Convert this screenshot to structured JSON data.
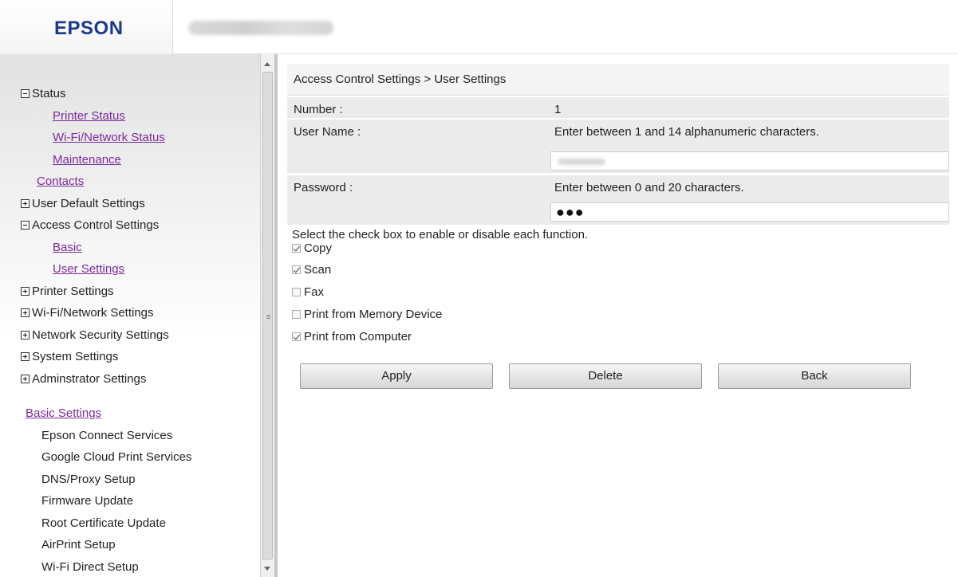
{
  "header": {
    "logo": "EPSON"
  },
  "sidebar": {
    "nav": [
      {
        "label": "Status",
        "toggle": "minus"
      },
      {
        "label": "Printer Status",
        "link": true,
        "level": 2
      },
      {
        "label": "Wi-Fi/Network Status",
        "link": true,
        "level": 2
      },
      {
        "label": "Maintenance",
        "link": true,
        "level": 2
      },
      {
        "label": "Contacts",
        "link": true,
        "level": 1
      },
      {
        "label": "User Default Settings",
        "toggle": "plus"
      },
      {
        "label": "Access Control Settings",
        "toggle": "minus"
      },
      {
        "label": "Basic",
        "link": true,
        "level": 2
      },
      {
        "label": "User Settings",
        "link": true,
        "level": 2
      },
      {
        "label": "Printer Settings",
        "toggle": "plus"
      },
      {
        "label": "Wi-Fi/Network Settings",
        "toggle": "plus"
      },
      {
        "label": "Network Security Settings",
        "toggle": "plus"
      },
      {
        "label": "System Settings",
        "toggle": "plus"
      },
      {
        "label": "Adminstrator Settings",
        "toggle": "plus"
      }
    ],
    "basic_settings": {
      "title": "Basic Settings",
      "items": [
        "Epson Connect Services",
        "Google Cloud Print Services",
        "DNS/Proxy Setup",
        "Firmware Update",
        "Root Certificate Update",
        "AirPrint Setup",
        "Wi-Fi Direct Setup"
      ]
    }
  },
  "main": {
    "breadcrumb": "Access Control Settings > User Settings",
    "number": {
      "label": "Number :",
      "value": "1"
    },
    "user_name": {
      "label": "User Name :",
      "hint": "Enter between 1 and 14 alphanumeric characters."
    },
    "password": {
      "label": "Password :",
      "hint": "Enter between 0 and 20 characters.",
      "value": "●●●"
    },
    "instruction": "Select the check box to enable or disable each function.",
    "functions": [
      {
        "label": "Copy",
        "checked": true
      },
      {
        "label": "Scan",
        "checked": true
      },
      {
        "label": "Fax",
        "checked": false
      },
      {
        "label": "Print from Memory Device",
        "checked": false
      },
      {
        "label": "Print from Computer",
        "checked": true
      }
    ],
    "buttons": {
      "apply": "Apply",
      "delete": "Delete",
      "back": "Back"
    }
  }
}
